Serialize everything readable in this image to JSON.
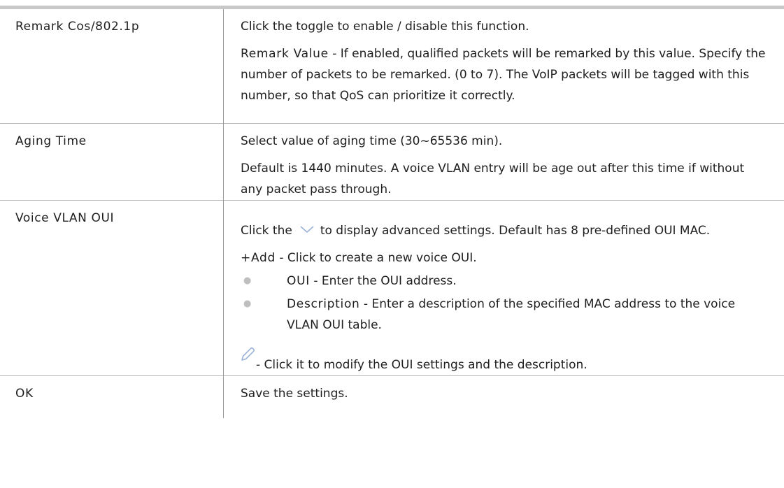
{
  "rows": [
    {
      "term": "Remark Cos/802.1p",
      "paras": [
        "Click the toggle to enable / disable this function."
      ],
      "kw_para": {
        "keyword": "Remark Value",
        "text": " - If enabled, qualified packets will be remarked by this value. Specify the number of packets to be remarked. (0 to 7). The VoIP packets will be tagged with this number, so that QoS can prioritize it correctly."
      }
    },
    {
      "term": "Aging Time",
      "paras": [
        "Select value of aging time (30~65536 min).",
        "Default is 1440 minutes. A voice VLAN entry will be age out after this time if without any packet pass through."
      ]
    },
    {
      "term": "Voice VLAN OUI",
      "chevron_before": "Click the",
      "chevron_after": "to display advanced settings. Default has 8 pre-defined OUI MAC.",
      "chevron_icon": "chevron-down-icon",
      "add_keyword": "+Add",
      "add_text": " - Click to create a new voice OUI.",
      "bullets": [
        {
          "keyword": "OUI",
          "text": " - Enter the OUI address."
        },
        {
          "keyword": "Description",
          "text": " - Enter a description of the specified MAC address to the voice VLAN OUI table."
        }
      ],
      "edit_icon": "pencil-icon",
      "edit_text": "- Click it to modify the OUI settings and the description."
    },
    {
      "term": "OK",
      "paras": [
        "Save the settings."
      ]
    }
  ],
  "colors": {
    "top_rule": "#c8c8c8",
    "divider": "#9a9a9a",
    "row_rule": "#b5b5b5",
    "icon": "#9bb3d8",
    "bullet": "#bfbfbf"
  }
}
